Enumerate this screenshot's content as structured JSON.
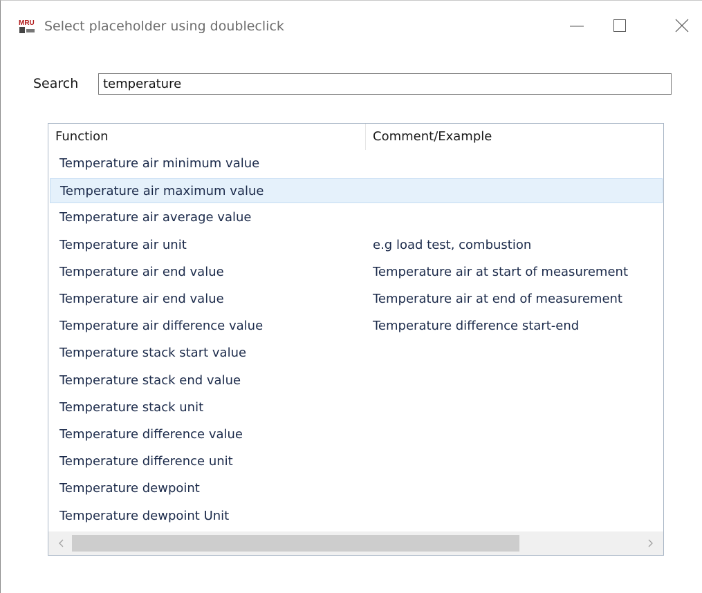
{
  "window": {
    "title": "Select placeholder using doubleclick",
    "app_icon_text": "MRU",
    "controls": {
      "minimize": "minimize-icon",
      "maximize": "maximize-icon",
      "close": "close-icon"
    }
  },
  "search": {
    "label": "Search",
    "value": "temperature"
  },
  "table": {
    "columns": [
      "Function",
      "Comment/Example"
    ],
    "selected_index": 1,
    "rows": [
      {
        "function": "Temperature air minimum value",
        "comment": ""
      },
      {
        "function": "Temperature air maximum value",
        "comment": ""
      },
      {
        "function": "Temperature air average value",
        "comment": ""
      },
      {
        "function": "Temperature air unit",
        "comment": "e.g load test, combustion"
      },
      {
        "function": "Temperature air end value",
        "comment": "Temperature air at start of measurement"
      },
      {
        "function": "Temperature air end value",
        "comment": "Temperature air at end of measurement"
      },
      {
        "function": "Temperature air difference value",
        "comment": "Temperature difference start-end"
      },
      {
        "function": "Temperature stack start value",
        "comment": ""
      },
      {
        "function": "Temperature stack end value",
        "comment": ""
      },
      {
        "function": "Temperature stack unit",
        "comment": ""
      },
      {
        "function": "Temperature difference value",
        "comment": ""
      },
      {
        "function": "Temperature difference unit",
        "comment": ""
      },
      {
        "function": "Temperature dewpoint",
        "comment": ""
      },
      {
        "function": "Temperature dewpoint Unit",
        "comment": ""
      }
    ],
    "scrollbar": {
      "left_arrow": "chevron-left-icon",
      "right_arrow": "chevron-right-icon"
    }
  },
  "colors": {
    "selection": "#e5f1fb",
    "selection_border": "#c4dcf3",
    "text": "#1b2a4a",
    "title_text": "#6d6d6d"
  }
}
